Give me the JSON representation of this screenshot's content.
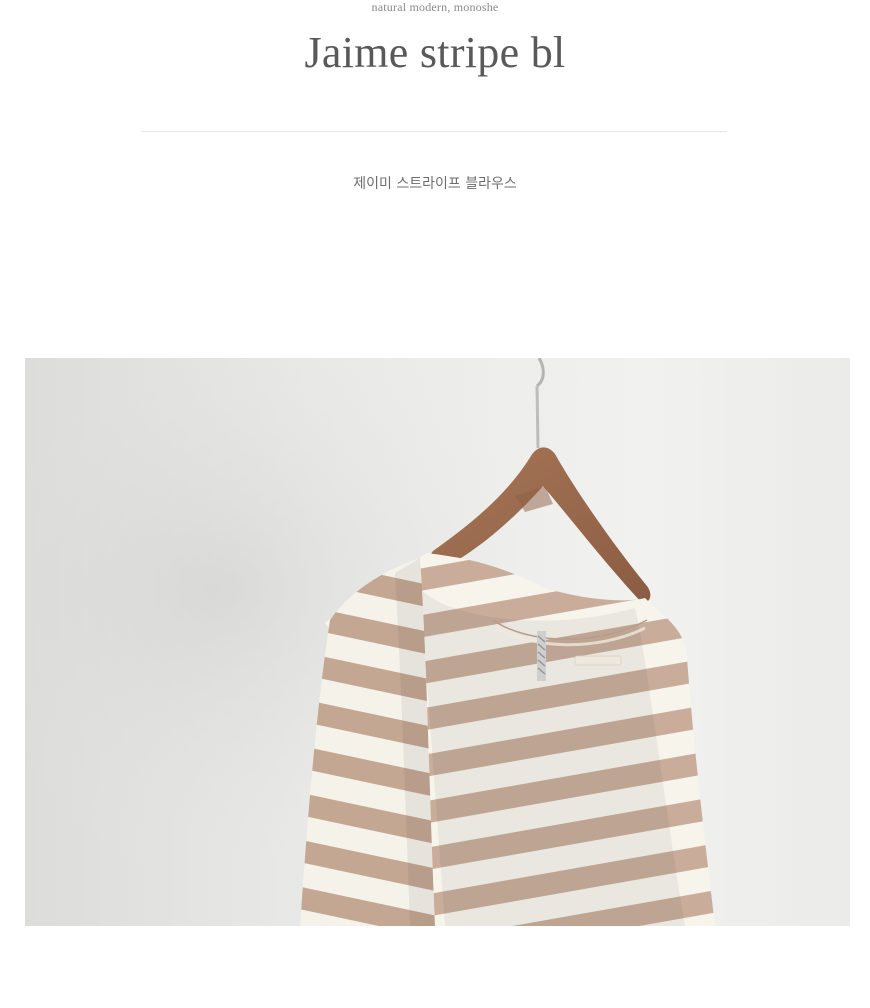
{
  "header": {
    "tagline": "natural modern, monoshe",
    "title": "Jaime stripe bl",
    "subtitle": "제이미 스트라이프 블라우스"
  },
  "product_photo": {
    "description_icon": "striped-blouse-on-hanger-photo"
  },
  "colors": {
    "background": "#ffffff",
    "title_text": "#595959",
    "divider": "#e7e7e7",
    "stripe_beige": "#c9ad9a",
    "stripe_cream": "#f7f4ec",
    "hanger_wood": "#9c6b4f",
    "wall": "#ececea"
  }
}
